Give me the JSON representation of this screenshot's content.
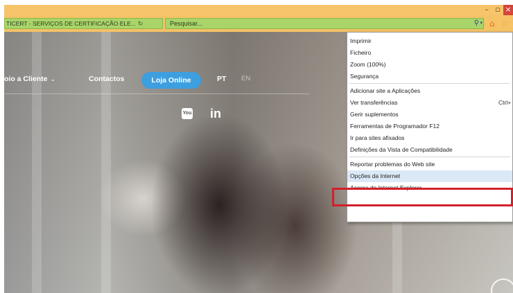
{
  "browser": {
    "address_text": "TICERT - SERVIÇOS DE CERTIFICAÇÃO ELE...",
    "refresh_glyph": "↻",
    "search_placeholder": "Pesquisar...",
    "search_glyph": "⚲",
    "dropdown_glyph": "▾",
    "home_glyph": "⌂",
    "favorites_glyph": "☆",
    "window_controls": {
      "minimize": "–",
      "maximize": "▫",
      "close": "×"
    }
  },
  "site": {
    "nav": {
      "apoio_label": "oio a Cliente",
      "apoio_caret": "⌄",
      "contactos_label": "Contactos",
      "loja_label": "Loja Online",
      "pt_label": "PT",
      "en_label": "EN"
    },
    "social": {
      "youtube_label": "You",
      "linkedin_label": "in"
    }
  },
  "tools_menu": {
    "items": [
      {
        "label": "Imprimir"
      },
      {
        "label": "Ficheiro"
      },
      {
        "label": "Zoom (100%)"
      },
      {
        "label": "Segurança"
      },
      {
        "label": "Adicionar site a Aplicações"
      },
      {
        "label": "Ver transferências",
        "shortcut": "Ctrl+"
      },
      {
        "label": "Gerir suplementos"
      },
      {
        "label": "Ferramentas de Programador F12"
      },
      {
        "label": "Ir para sites afixados"
      },
      {
        "label": "Definições da Vista de Compatibilidade"
      },
      {
        "label": "Reportar problemas do Web site"
      },
      {
        "label": "Opções da Internet",
        "highlighted": true
      },
      {
        "label": "Acerca do Internet Explorer"
      }
    ]
  },
  "colors": {
    "chrome_bar": "#f5c266",
    "address_bar": "#a9d46a",
    "loja_button": "#3d9fe0",
    "highlight_border": "#d2202a"
  }
}
